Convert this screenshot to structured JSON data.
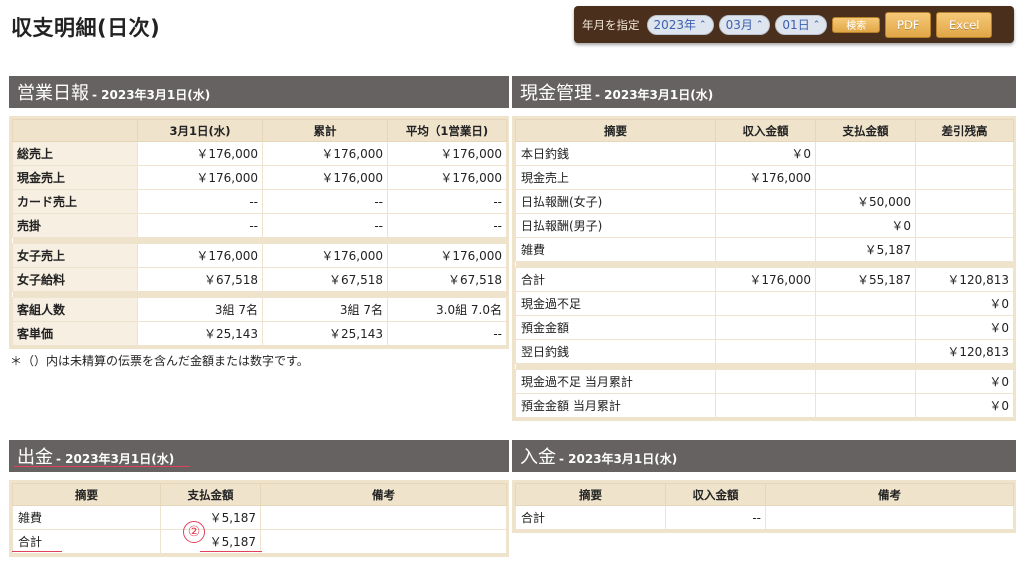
{
  "page": {
    "title": "収支明細(日次)"
  },
  "toolbar": {
    "label": "年月を指定",
    "year": "2023年",
    "month": "03月",
    "day": "01日",
    "search": "検索",
    "pdf": "PDF",
    "excel": "Excel"
  },
  "sales": {
    "name": "営業日報",
    "date": "- 2023年3月1日(水)",
    "headers": [
      "",
      "3月1日(水)",
      "累計",
      "平均（1営業日)"
    ],
    "groups": [
      [
        [
          "総売上",
          "￥176,000",
          "￥176,000",
          "￥176,000"
        ],
        [
          "現金売上",
          "￥176,000",
          "￥176,000",
          "￥176,000"
        ],
        [
          "カード売上",
          "--",
          "--",
          "--"
        ],
        [
          "売掛",
          "--",
          "--",
          "--"
        ]
      ],
      [
        [
          "女子売上",
          "￥176,000",
          "￥176,000",
          "￥176,000"
        ],
        [
          "女子給料",
          "￥67,518",
          "￥67,518",
          "￥67,518"
        ]
      ],
      [
        [
          "客組人数",
          "3組 7名",
          "3組 7名",
          "3.0組 7.0名"
        ],
        [
          "客単価",
          "￥25,143",
          "￥25,143",
          "--"
        ]
      ]
    ],
    "note": "＊（）内は未精算の伝票を含んだ金額または数字です。"
  },
  "cash": {
    "name": "現金管理",
    "date": "- 2023年3月1日(水)",
    "headers": [
      "摘要",
      "収入金額",
      "支払金額",
      "差引残高"
    ],
    "groups": [
      [
        [
          "本日釣銭",
          "￥0",
          "",
          ""
        ],
        [
          "現金売上",
          "￥176,000",
          "",
          ""
        ],
        [
          "日払報酬(女子)",
          "",
          "￥50,000",
          ""
        ],
        [
          "日払報酬(男子)",
          "",
          "￥0",
          ""
        ],
        [
          "雑費",
          "",
          "￥5,187",
          ""
        ]
      ],
      [
        [
          "合計",
          "￥176,000",
          "￥55,187",
          "￥120,813"
        ],
        [
          "現金過不足",
          "",
          "",
          "￥0"
        ],
        [
          "預金金額",
          "",
          "",
          "￥0"
        ],
        [
          "翌日釣銭",
          "",
          "",
          "￥120,813"
        ]
      ],
      [
        [
          "現金過不足 当月累計",
          "",
          "",
          "￥0"
        ],
        [
          "預金金額 当月累計",
          "",
          "",
          "￥0"
        ]
      ]
    ]
  },
  "out": {
    "name": "出金",
    "date": "- 2023年3月1日(水)",
    "headers": [
      "摘要",
      "支払金額",
      "備考"
    ],
    "rows": [
      [
        "雑費",
        "￥5,187",
        ""
      ],
      [
        "合計",
        "￥5,187",
        ""
      ]
    ],
    "annotation": "②"
  },
  "in": {
    "name": "入金",
    "date": "- 2023年3月1日(水)",
    "headers": [
      "摘要",
      "収入金額",
      "備考"
    ],
    "rows": [
      [
        "合計",
        "--",
        ""
      ]
    ]
  },
  "colors": {
    "header_bg": "#666262",
    "table_frame": "#efe3cc",
    "toolbar_bg": "#4a2f1c",
    "annotation": "#e0405a"
  }
}
